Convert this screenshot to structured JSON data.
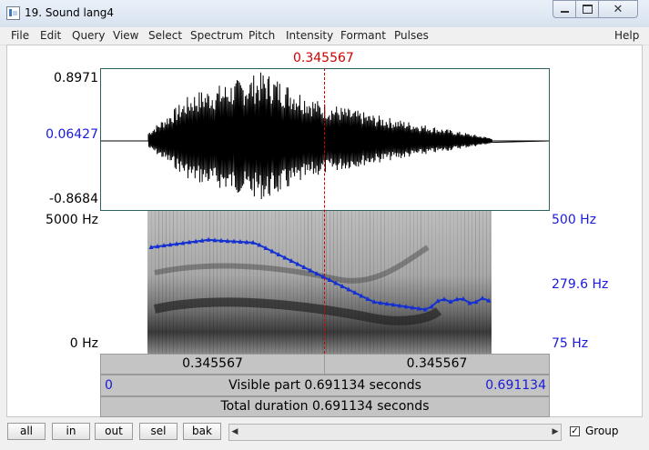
{
  "window": {
    "title": "19. Sound lang4"
  },
  "menu": [
    "File",
    "Edit",
    "Query",
    "View",
    "Select",
    "Spectrum",
    "Pitch",
    "Intensity",
    "Formant",
    "Pulses",
    "Help"
  ],
  "cursor_time": "0.345567",
  "waveform": {
    "ymax": "0.8971",
    "ymid": "0.06427",
    "ymin": "-0.8684"
  },
  "spectrogram": {
    "freq_top": "5000 Hz",
    "freq_bottom": "0 Hz"
  },
  "pitch": {
    "top": "500 Hz",
    "mid": "279.6 Hz",
    "bottom": "75 Hz"
  },
  "bars": {
    "left_segment": "0.345567",
    "right_segment": "0.345567",
    "visible_start": "0",
    "visible_part": "Visible part 0.691134 seconds",
    "visible_end": "0.691134",
    "total_duration": "Total duration 0.691134 seconds"
  },
  "toolbar": {
    "all": "all",
    "in": "in",
    "out": "out",
    "sel": "sel",
    "bak": "bak",
    "group": "Group",
    "group_checked": true
  },
  "colors": {
    "cursor": "#d00000",
    "pitch": "#1530d0",
    "axis_blue": "#1a1ad8",
    "bar_gray": "#c4c4c4"
  },
  "icons": {
    "minimize": "minimize-icon",
    "maximize": "maximize-icon",
    "close": "close-icon"
  }
}
